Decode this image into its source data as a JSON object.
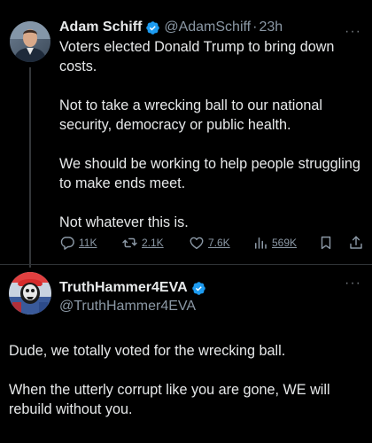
{
  "colors": {
    "background": "#000000",
    "text": "#e7e9ea",
    "secondary": "#8b98a5",
    "verified_blue": "#1d9bf0"
  },
  "tweet_main": {
    "author_name": "Adam Schiff",
    "handle": "@AdamSchiff",
    "separator": "·",
    "time": "23h",
    "paragraphs": [
      "Voters elected Donald Trump to bring down costs.",
      "Not to take a wrecking ball to our national security, democracy or public health.",
      "We should be working to help people struggling to make ends meet.",
      "Not whatever this is."
    ],
    "actions": {
      "replies": "11K",
      "reposts": "2.1K",
      "likes": "7.6K",
      "views": "569K"
    },
    "more": "···"
  },
  "tweet_reply": {
    "author_name": "TruthHammer4EVA",
    "handle": "@TruthHammer4EVA",
    "paragraphs": [
      "Dude, we totally voted for the wrecking ball.",
      "When the utterly corrupt like you are gone, WE will rebuild without you."
    ],
    "more": "···"
  },
  "icons": [
    "verified-icon",
    "more-icon",
    "reply-icon",
    "repost-icon",
    "like-icon",
    "views-icon",
    "bookmark-icon",
    "share-icon"
  ]
}
